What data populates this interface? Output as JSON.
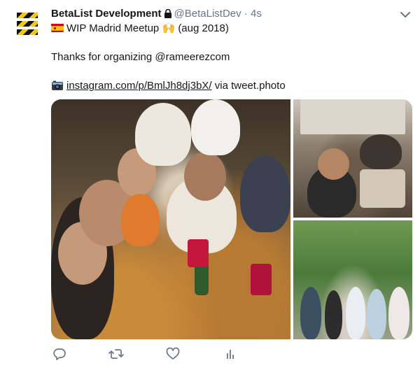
{
  "tweet": {
    "author_name": "BetaList Development",
    "author_handle": "@BetaListDev",
    "separator": "·",
    "time": "4s",
    "text_line1_flag": "spain-flag-emoji",
    "text_line1_title": "WIP Madrid Meetup",
    "text_line1_emoji": "🙌",
    "text_line1_suffix": "(aug 2018)",
    "text_line2_prefix": "Thanks for organizing ",
    "text_line2_mention": "@rameerezcom",
    "text_line3_icon": "camera-emoji",
    "text_line3_link": "instagram.com/p/BmlJh8dj3bX/",
    "text_line3_suffix": " via tweet.photo"
  },
  "media": {
    "photos": [
      "restaurant-group-selfie",
      "group-at-table",
      "group-in-garden"
    ]
  },
  "actions": {
    "icons": [
      "reply-icon",
      "retweet-icon",
      "like-icon",
      "analytics-icon"
    ]
  },
  "colors": {
    "text": "#14171a",
    "secondary": "#657786",
    "avatar_stripe_dark": "#111111",
    "avatar_stripe_yellow": "#f2c811"
  }
}
